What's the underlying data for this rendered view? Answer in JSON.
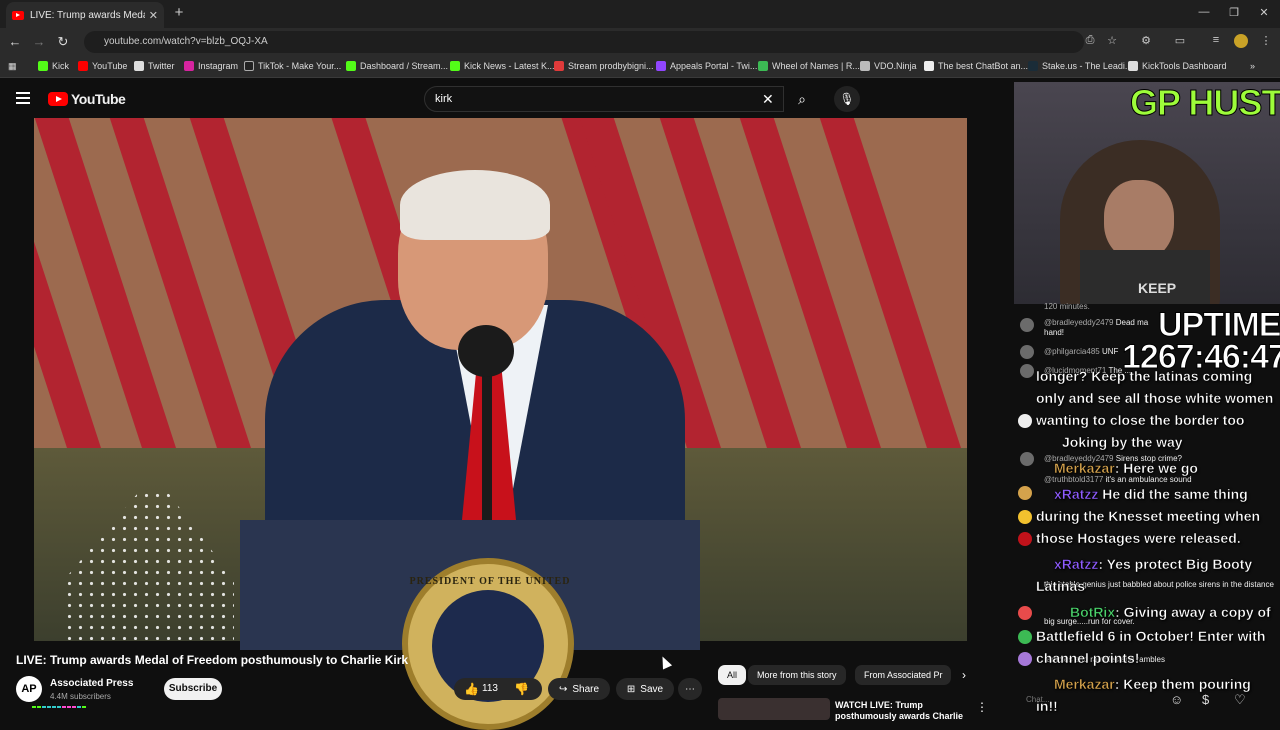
{
  "browser": {
    "tab_title": "LIVE: Trump awards Medal",
    "url": "youtube.com/watch?v=blzb_OQJ-XA",
    "bookmarks": [
      "Kick",
      "YouTube",
      "Twitter",
      "Instagram",
      "TikTok - Make Your...",
      "Dashboard / Stream...",
      "Kick News - Latest K...",
      "Stream prodbybigni...",
      "Appeals Portal - Twi...",
      "Wheel of Names | R...",
      "VDO.Ninja",
      "The best ChatBot an...",
      "Stake.us - The Leadi...",
      "KickTools Dashboard"
    ]
  },
  "youtube": {
    "logo": "YouTube",
    "search_value": "kirk",
    "video_title": "LIVE: Trump awards Medal of Freedom posthumously to Charlie Kirk",
    "seal_text": "PRESIDENT OF THE UNITED",
    "channel_avatar": "AP",
    "channel_name": "Associated Press",
    "channel_subs": "4.4M subscribers",
    "subscribe": "Subscribe",
    "likes": "113",
    "share": "Share",
    "save": "Save",
    "chips": [
      "All",
      "More from this story",
      "From Associated Pr"
    ],
    "rec_title": "WATCH LIVE: Trump posthumously awards Charlie"
  },
  "stream": {
    "brand": "GP HUSTLA",
    "shirt_text": "KEEP",
    "uptime_label": "UPTIME",
    "uptime_value": "1267:46:47",
    "chat_placeholder": "Chat...",
    "small_chat": [
      {
        "user": "",
        "text": "120 minutes."
      },
      {
        "user": "@bradleyeddy2479",
        "text": "Dead ma"
      },
      {
        "user": "",
        "text": "hand!"
      },
      {
        "user": "@philgarcia485",
        "text": "UNF"
      },
      {
        "user": "@lucidmoment71",
        "text": "The ..."
      },
      {
        "user": "@bradleyeddy2479",
        "text": "Sirens stop crime?"
      },
      {
        "user": "@truthbtold3177",
        "text": "it's an ambulance sound"
      },
      {
        "user": "",
        "text": "this stable genius just babbled about police sirens in the distance"
      },
      {
        "user": "",
        "text": "big surge.....run for cover."
      },
      {
        "user": "",
        "text": "rambles and rambles and rambles"
      }
    ],
    "overlay_chat": [
      {
        "user": "",
        "text": "longer? Keep the latinas coming"
      },
      {
        "user": "",
        "text": "only and see all those white women"
      },
      {
        "user": "",
        "text": "wanting to close the border too"
      },
      {
        "user": "",
        "text": "Joking by the way"
      },
      {
        "user": "Merkazar",
        "text": ": Here we go"
      },
      {
        "user": "xRatzz",
        "text": "He did the same thing"
      },
      {
        "user": "",
        "text": "during the Knesset meeting when"
      },
      {
        "user": "",
        "text": "those Hostages were released."
      },
      {
        "user": "xRatzz",
        "text": ": Yes protect Big Booty"
      },
      {
        "user": "",
        "text": "Latinas"
      },
      {
        "user": "BotRix",
        "text": ": Giving away a copy of"
      },
      {
        "user": "",
        "text": "Battlefield 6 in October! Enter with"
      },
      {
        "user": "",
        "text": "channel points!"
      },
      {
        "user": "Merkazar",
        "text": ": Keep them pouring"
      },
      {
        "user": "",
        "text": "in!!"
      }
    ]
  },
  "colors": {
    "accent": "#ff0000",
    "brand_green": "#9dfc3a"
  }
}
